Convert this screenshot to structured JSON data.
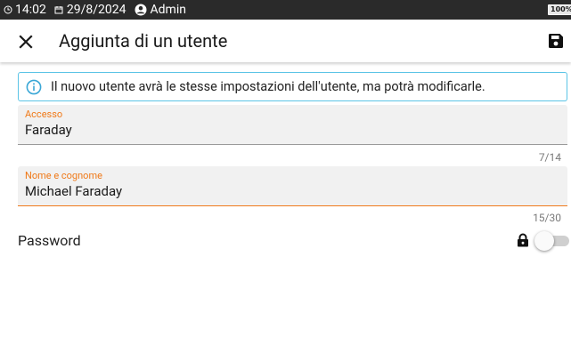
{
  "statusbar": {
    "time": "14:02",
    "date": "29/8/2024",
    "user": "Admin",
    "battery": "100%"
  },
  "appbar": {
    "title": "Aggiunta di un utente"
  },
  "info": {
    "message": "Il nuovo utente avrà le stesse impostazioni dell'utente, ma potrà modificarle."
  },
  "form": {
    "access": {
      "label": "Accesso",
      "value": "Faraday",
      "counter": "7/14"
    },
    "fullname": {
      "label": "Nome e cognome",
      "value": "Michael Faraday",
      "counter": "15/30"
    },
    "password": {
      "label": "Password",
      "enabled": false
    }
  },
  "colors": {
    "accent": "#f07a1a",
    "info_border": "#5bc4e6",
    "statusbar_bg": "#2a2a2a",
    "field_bg": "#f1f1f1"
  }
}
